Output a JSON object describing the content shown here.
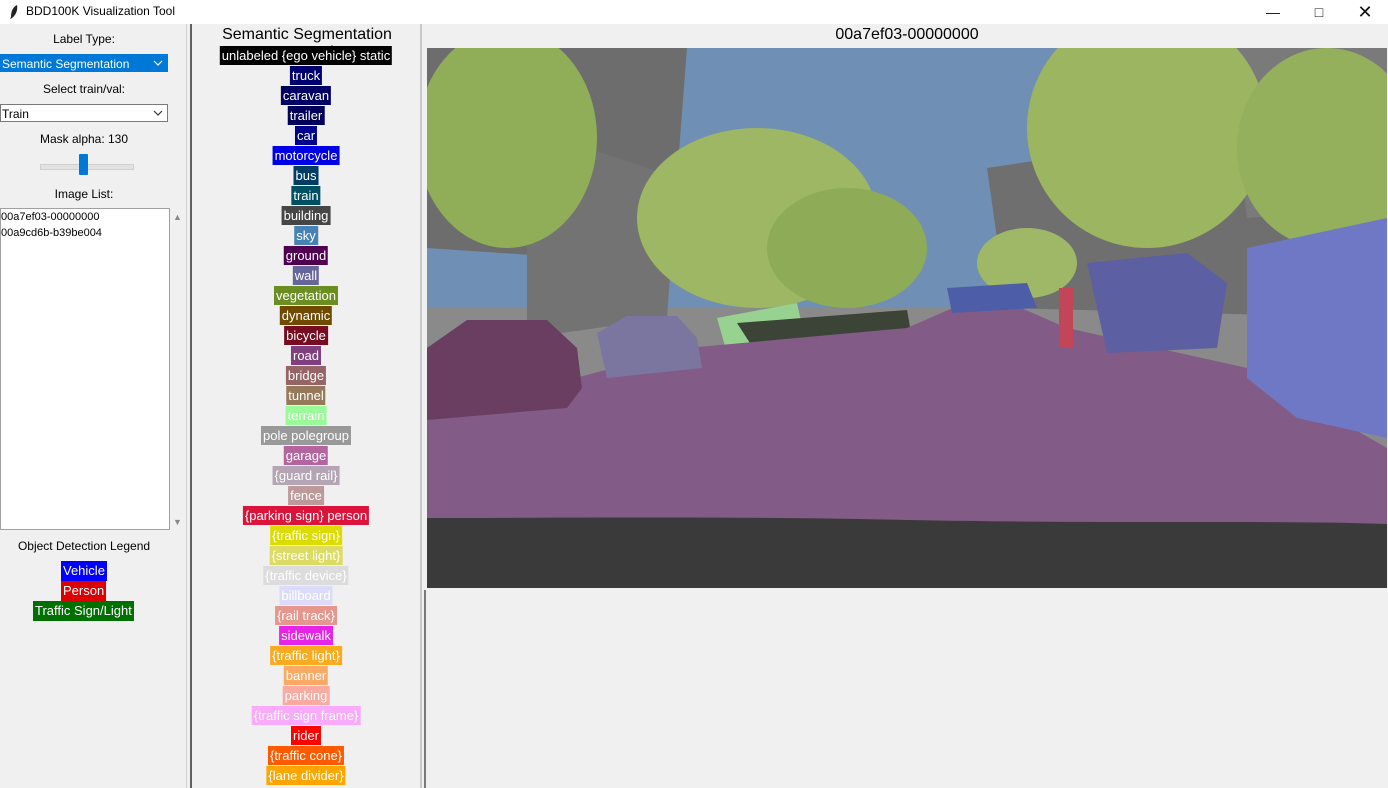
{
  "window": {
    "title": "BDD100K Visualization Tool",
    "min_glyph": "—",
    "max_glyph": "□",
    "close_glyph": "✕"
  },
  "left_panel": {
    "label_type_label": "Label Type:",
    "label_type_value": "Semantic Segmentation",
    "split_label": "Select train/val:",
    "split_value": "Train",
    "mask_alpha_label": "Mask alpha: 130",
    "image_list_label": "Image List:",
    "image_list": [
      "00a7ef03-00000000",
      "00a9cd6b-b39be004"
    ],
    "od_legend_title": "Object Detection Legend",
    "od_legend": [
      {
        "label": "Vehicle",
        "color": "#0000ff"
      },
      {
        "label": "Person",
        "color": "#dc0000"
      },
      {
        "label": "Traffic Sign/Light",
        "color": "#007000"
      }
    ]
  },
  "legend": {
    "title": "Semantic Segmentation Legend",
    "items": [
      {
        "label": "unlabeled {ego vehicle} static",
        "color": "#000000"
      },
      {
        "label": "truck",
        "color": "#00006e"
      },
      {
        "label": "caravan",
        "color": "#000064"
      },
      {
        "label": "trailer",
        "color": "#00005a"
      },
      {
        "label": "car",
        "color": "#00008e"
      },
      {
        "label": "motorcycle",
        "color": "#0000e6"
      },
      {
        "label": "bus",
        "color": "#003c64"
      },
      {
        "label": "train",
        "color": "#005064"
      },
      {
        "label": "building",
        "color": "#464646"
      },
      {
        "label": "sky",
        "color": "#4682b4"
      },
      {
        "label": "ground",
        "color": "#510051"
      },
      {
        "label": "wall",
        "color": "#66669c"
      },
      {
        "label": "vegetation",
        "color": "#6b8e23"
      },
      {
        "label": "dynamic",
        "color": "#6f4a00"
      },
      {
        "label": "bicycle",
        "color": "#770b20"
      },
      {
        "label": "road",
        "color": "#804080"
      },
      {
        "label": "bridge",
        "color": "#966464"
      },
      {
        "label": "tunnel",
        "color": "#96785a"
      },
      {
        "label": "terrain",
        "color": "#98fb98"
      },
      {
        "label": "pole polegroup",
        "color": "#999999"
      },
      {
        "label": "garage",
        "color": "#b4649e"
      },
      {
        "label": "{guard rail}",
        "color": "#b4a5b4"
      },
      {
        "label": "fence",
        "color": "#be9999"
      },
      {
        "label": "{parking sign} person",
        "color": "#dc143c"
      },
      {
        "label": "{traffic sign}",
        "color": "#dcdc00"
      },
      {
        "label": "{street light}",
        "color": "#dcdc64"
      },
      {
        "label": "{traffic device}",
        "color": "#dcdcdc"
      },
      {
        "label": "billboard",
        "color": "#dcdcfa"
      },
      {
        "label": "{rail track}",
        "color": "#e6968c"
      },
      {
        "label": "sidewalk",
        "color": "#e823e8"
      },
      {
        "label": "{traffic light}",
        "color": "#faaa1e"
      },
      {
        "label": "banner",
        "color": "#faaa64"
      },
      {
        "label": "parking",
        "color": "#faaaa0"
      },
      {
        "label": "{traffic sign frame}",
        "color": "#faaafa"
      },
      {
        "label": "rider",
        "color": "#ff0000"
      },
      {
        "label": "{traffic cone}",
        "color": "#ff5a00"
      },
      {
        "label": "{lane divider}",
        "color": "#ffa500"
      }
    ]
  },
  "main": {
    "image_title": "00a7ef03-00000000"
  }
}
